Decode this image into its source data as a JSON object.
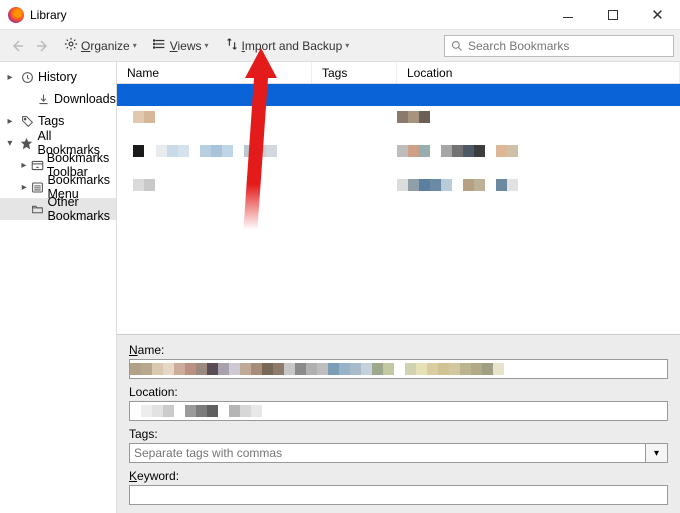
{
  "window": {
    "title": "Library"
  },
  "toolbar": {
    "organize": "Organize",
    "views": "Views",
    "import": "Import and Backup"
  },
  "search": {
    "placeholder": "Search Bookmarks"
  },
  "sidebar": {
    "history": "History",
    "downloads": "Downloads",
    "tags": "Tags",
    "allbookmarks": "All Bookmarks",
    "toolbar": "Bookmarks Toolbar",
    "menu": "Bookmarks Menu",
    "other": "Other Bookmarks"
  },
  "columns": {
    "name": "Name",
    "tags": "Tags",
    "location": "Location"
  },
  "details": {
    "name_label": "Name:",
    "location_label": "Location:",
    "tags_label": "Tags:",
    "tags_placeholder": "Separate tags with commas",
    "keyword_label": "Keyword:"
  },
  "pixel_rows": {
    "r1_name": [
      "#e3c8b0",
      "#d8b69a"
    ],
    "r1_loc": [
      "#8a7a6c",
      "#a8947e",
      "#6b6055"
    ],
    "r2_name": [
      "#1a1a1a"
    ],
    "r2_name_ext": [
      "#e8ecef",
      "#c9dae8",
      "#d4e2ee",
      "",
      "#b8cfdf",
      "#a7c4db",
      "#c0d6e6",
      "",
      "#bcc6cf",
      "#c8cfd6",
      "#d2d8dd"
    ],
    "r2_loc": [
      "#bdbdbd",
      "#cfa088",
      "#97adae",
      "",
      "#a6a6a6",
      "#727272",
      "#4d5a66",
      "#3d3d3d",
      "",
      "#dcb896",
      "#cdc1a8"
    ],
    "r3_name": [
      "#dadada",
      "#c9c9c9"
    ],
    "r3_loc": [
      "#dcdcdc",
      "#8f9fa8",
      "#5b7f9e",
      "#6a8aa6",
      "#b8cdd9",
      "",
      "#b6a083",
      "#bdb198",
      "",
      "#6c89a0",
      "#e2e2e2"
    ]
  },
  "details_swatches": {
    "name": [
      "#b1a186",
      "#b7a78d",
      "#d9c7b0",
      "#e5d7c3",
      "#ccac9b",
      "#bb9281",
      "#9a8b7e",
      "#5a4c56",
      "#a8a1ad",
      "#cfc9d4",
      "#c0a997",
      "#a88c7a",
      "#796858",
      "#8d7c6c",
      "#c7c7c7",
      "#8b8b8b",
      "#b0b0b0",
      "#bebebe",
      "#7c9db6",
      "#98b3c8",
      "#a7bbcb",
      "#c5d1db",
      "#9ea88c",
      "#c2c8a1",
      "",
      "#d0d2b0",
      "#e6e1b6",
      "#d9cda1",
      "#d1c293",
      "#d2c79f",
      "#bcb48e",
      "#b0aa87",
      "#a19f83",
      "#e8e4cc"
    ],
    "location": [
      "",
      "#ededed",
      "#e2e2e2",
      "#cbcbcb",
      "",
      "#9a9a9a",
      "#7c7c7c",
      "#606060",
      "",
      "#b5b5b5",
      "#d7d7d7",
      "#e8e8e8"
    ]
  }
}
